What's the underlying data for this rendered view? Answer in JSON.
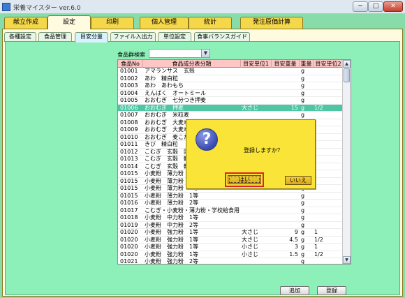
{
  "window": {
    "title": "栄養マイスター ver.6.0",
    "minimize": "─",
    "maximize": "□",
    "close": "✕"
  },
  "main_tabs": [
    {
      "label": "献立作成"
    },
    {
      "label": "設定"
    },
    {
      "label": "印刷"
    },
    {
      "label": "個人管理"
    },
    {
      "label": "統計"
    },
    {
      "label": "発注原価計算"
    }
  ],
  "sub_tabs": [
    {
      "label": "各種設定"
    },
    {
      "label": "食品管理"
    },
    {
      "label": "目安分量"
    },
    {
      "label": "ファイル入出力"
    },
    {
      "label": "単位設定"
    },
    {
      "label": "食事バランスガイド"
    }
  ],
  "search": {
    "label": "食品群検索",
    "value": ""
  },
  "table": {
    "columns": [
      "食品No",
      "食品成分表分類",
      "目安単位1",
      "目安重量",
      "重量",
      "目安単位2"
    ],
    "rows": [
      [
        "01001",
        "アマランサス　玄殻",
        "",
        "",
        "g",
        ""
      ],
      [
        "01002",
        "あわ　精白粒",
        "",
        "",
        "g",
        ""
      ],
      [
        "01003",
        "あわ　あわもち",
        "",
        "",
        "g",
        ""
      ],
      [
        "01004",
        "えんばく　オートミール",
        "",
        "",
        "g",
        ""
      ],
      [
        "01005",
        "おおむぎ　七分つき押麦",
        "",
        "",
        "g",
        ""
      ],
      [
        "01006",
        "おおむぎ　押麦",
        "大さじ",
        "15",
        "g",
        "1/2"
      ],
      [
        "01007",
        "おおむぎ　米粒麦",
        "",
        "",
        "g",
        ""
      ],
      [
        "01008",
        "おおむぎ　大麦めん　乾",
        "",
        "",
        "g",
        ""
      ],
      [
        "01009",
        "おおむぎ　大麦めん",
        "",
        "",
        "g",
        ""
      ],
      [
        "01010",
        "おおむぎ　麦こがし",
        "",
        "",
        "g",
        ""
      ],
      [
        "01011",
        "きび　精白粒",
        "",
        "",
        "g",
        ""
      ],
      [
        "01012",
        "こむぎ　玄穀　国産",
        "",
        "",
        "g",
        ""
      ],
      [
        "01013",
        "こむぎ　玄穀　輸入",
        "",
        "",
        "g",
        ""
      ],
      [
        "01014",
        "こむぎ　玄穀　輸入",
        "",
        "",
        "g",
        ""
      ],
      [
        "01015",
        "小麦粉　薄力粉　1等",
        "",
        "",
        "g",
        ""
      ],
      [
        "01015",
        "小麦粉　薄力粉　1等",
        "",
        "",
        "g",
        ""
      ],
      [
        "01015",
        "小麦粉　薄力粉　1等",
        "",
        "",
        "g",
        ""
      ],
      [
        "01015",
        "小麦粉　薄力粉　1等",
        "",
        "",
        "g",
        ""
      ],
      [
        "01016",
        "小麦粉　薄力粉　2等",
        "",
        "",
        "g",
        ""
      ],
      [
        "01017",
        "こむぎ・小麦粉・薄力粉・学校給食用",
        "",
        "",
        "g",
        ""
      ],
      [
        "01018",
        "小麦粉　中力粉　1等",
        "",
        "",
        "g",
        ""
      ],
      [
        "01019",
        "小麦粉　中力粉　2等",
        "",
        "",
        "g",
        ""
      ],
      [
        "01020",
        "小麦粉　強力粉　1等",
        "大さじ",
        "9",
        "g",
        "1"
      ],
      [
        "01020",
        "小麦粉　強力粉　1等",
        "大さじ",
        "4.5",
        "g",
        "1/2"
      ],
      [
        "01020",
        "小麦粉　強力粉　1等",
        "小さじ",
        "3",
        "g",
        "1"
      ],
      [
        "01020",
        "小麦粉　強力粉　1等",
        "小さじ",
        "1.5",
        "g",
        "1/2"
      ],
      [
        "01021",
        "小麦粉　強力粉　2等",
        "",
        "",
        "g",
        ""
      ]
    ],
    "selected_index": 5
  },
  "buttons": {
    "add": "追加",
    "register": "登録"
  },
  "dialog": {
    "message": "登録しますか？",
    "yes": "はい",
    "no": "いいえ",
    "icon": "question-icon"
  },
  "colors": {
    "main_tab": "#f5d84a",
    "content": "#8ef0b9",
    "header": "#ffc6c6",
    "selected_row": "#4ec6a4",
    "dialog": "#f9e437",
    "highlight": "#e0202a"
  }
}
